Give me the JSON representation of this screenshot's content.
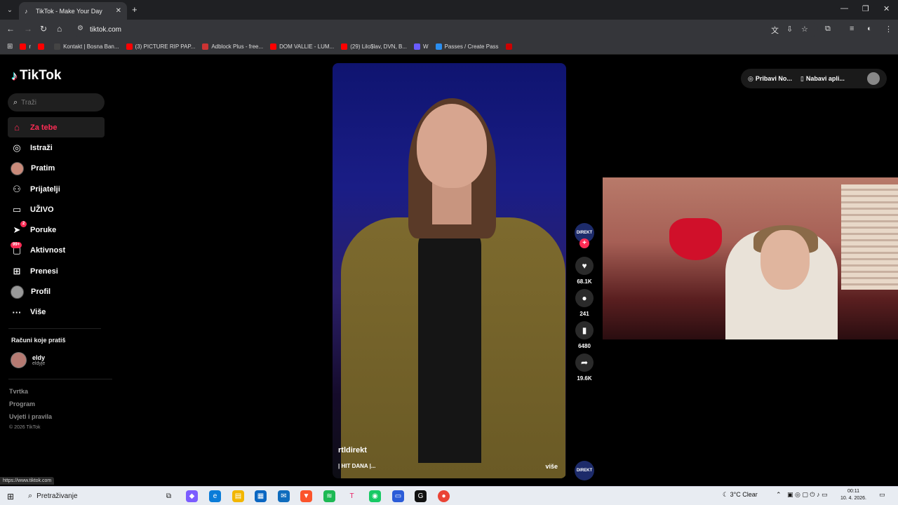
{
  "browser": {
    "tab_title": "TikTok - Make Your Day",
    "tab_close": "✕",
    "new_tab": "+",
    "url": "tiktok.com",
    "bookmarks": [
      {
        "label": "r",
        "color": "#ff0000"
      },
      {
        "label": "",
        "color": "#ff0000"
      },
      {
        "label": "Kontakt | Bosna Ban...",
        "color": "#444"
      },
      {
        "label": "(3) PICTURE RIP PAP...",
        "color": "#ff0000"
      },
      {
        "label": "Adblock Plus - free...",
        "color": "#c33"
      },
      {
        "label": "DOM VALLIE - LUM...",
        "color": "#ff0000"
      },
      {
        "label": "(29) Lilo$lav, DVN, B...",
        "color": "#ff0000"
      },
      {
        "label": "W",
        "color": "#6a5cff"
      },
      {
        "label": "Passes / Create Pass",
        "color": "#2a8ef0"
      },
      {
        "label": "",
        "color": "#c00"
      }
    ],
    "status_url": "https://www.tiktok.com"
  },
  "tiktok": {
    "logo_text": "TikTok",
    "search_placeholder": "Traži",
    "nav": [
      {
        "label": "Za tebe",
        "icon": "home-icon",
        "glyph": "⌂",
        "active": true
      },
      {
        "label": "Istraži",
        "icon": "compass-icon",
        "glyph": "◎"
      },
      {
        "label": "Pratim",
        "icon": "avatar",
        "glyph": ""
      },
      {
        "label": "Prijatelji",
        "icon": "friends-icon",
        "glyph": "⚇"
      },
      {
        "label": "UŽIVO",
        "icon": "live-tv-icon",
        "glyph": "▭"
      },
      {
        "label": "Poruke",
        "icon": "send-icon",
        "glyph": "➤",
        "badge": "2"
      },
      {
        "label": "Aktivnost",
        "icon": "activity-icon",
        "glyph": "▢",
        "badge": "99+"
      },
      {
        "label": "Prenesi",
        "icon": "upload-plus-icon",
        "glyph": "⊞"
      },
      {
        "label": "Profil",
        "icon": "avatar",
        "glyph": ""
      },
      {
        "label": "Više",
        "icon": "more-dots-icon",
        "glyph": "···"
      }
    ],
    "following_heading": "Računi koje pratiš",
    "following": [
      {
        "name": "eldy",
        "handle": "eldyje"
      }
    ],
    "footer": [
      "Tvrtka",
      "Program",
      "Uvjeti i pravila"
    ],
    "copyright": "© 2026 TikTok",
    "top_right": {
      "get_coins": "Pribavi No...",
      "get_app": "Nabavi apli..."
    },
    "video": {
      "username": "rtldirekt",
      "description": "| HIT DANA |...",
      "more": "više",
      "creator_label": "DIREKT",
      "likes": "68.1K",
      "comments": "241",
      "saves": "6480",
      "shares": "19.6K"
    }
  },
  "taskbar": {
    "search_placeholder": "Pretraživanje",
    "weather": "3°C  Clear",
    "time": "00:11",
    "date": "10. 4. 2026."
  }
}
